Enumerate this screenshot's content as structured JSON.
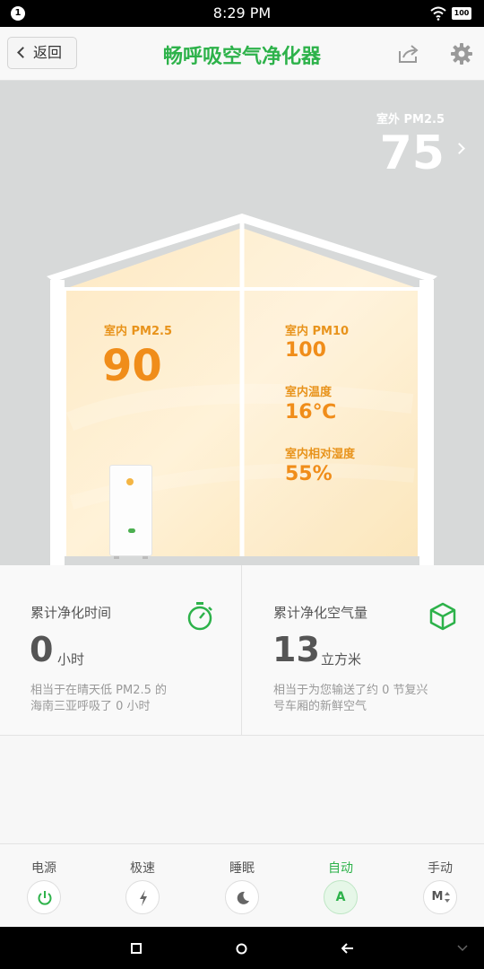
{
  "status_bar": {
    "notification_count": "1",
    "time": "8:29 PM",
    "battery": "100"
  },
  "app_bar": {
    "back_label": "返回",
    "title": "畅呼吸空气净化器"
  },
  "outdoor": {
    "label": "室外 PM2.5",
    "value": "75"
  },
  "indoor": {
    "pm25_label": "室内 PM2.5",
    "pm25_value": "90",
    "pm10_label": "室内 PM10",
    "pm10_value": "100",
    "temp_label": "室内温度",
    "temp_value": "16℃",
    "humidity_label": "室内相对湿度",
    "humidity_value": "55%"
  },
  "stats": {
    "time": {
      "title": "累计净化时间",
      "value": "0",
      "unit": "小时",
      "desc_line1": "相当于在晴天低 PM2.5 的",
      "desc_line2": "海南三亚呼吸了 0 小时"
    },
    "air": {
      "title": "累计净化空气量",
      "value": "13",
      "unit": "立方米",
      "desc_line1": "相当于为您输送了约 0 节复兴",
      "desc_line2": "号车厢的新鲜空气"
    }
  },
  "controls": [
    {
      "label": "电源",
      "icon": "power-icon"
    },
    {
      "label": "极速",
      "icon": "lightning-icon"
    },
    {
      "label": "睡眠",
      "icon": "moon-icon"
    },
    {
      "label": "自动",
      "icon": "auto-icon",
      "glyph": "A",
      "active": true
    },
    {
      "label": "手动",
      "icon": "manual-icon",
      "glyph": "M"
    }
  ],
  "colors": {
    "accent": "#2db24a",
    "indoor_text": "#f08d1a"
  }
}
